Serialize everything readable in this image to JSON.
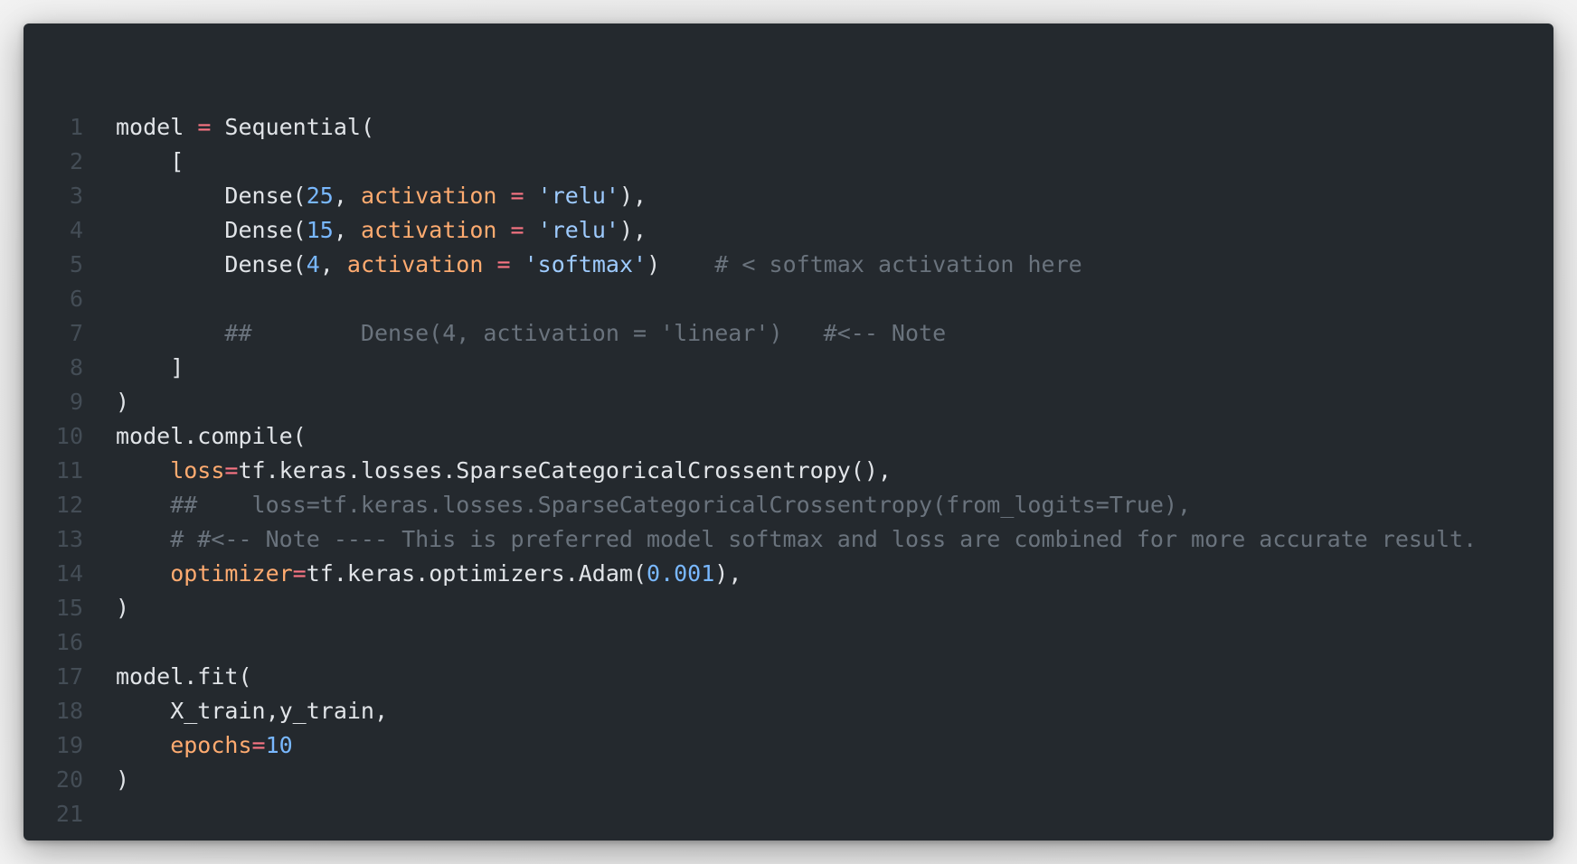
{
  "editor": {
    "theme_colors": {
      "background": "#24292e",
      "text": "#e1e4e8",
      "line_number": "#444d56",
      "operator": "#f97583",
      "keyword_arg": "#ffab70",
      "number": "#79b8ff",
      "string": "#9ecbff",
      "comment": "#6a737d"
    },
    "lines": [
      {
        "n": "1",
        "tokens": [
          [
            "id",
            "model "
          ],
          [
            "op",
            "="
          ],
          [
            "id",
            " Sequential("
          ]
        ]
      },
      {
        "n": "2",
        "tokens": [
          [
            "id",
            "    ["
          ]
        ]
      },
      {
        "n": "3",
        "tokens": [
          [
            "id",
            "        Dense("
          ],
          [
            "num",
            "25"
          ],
          [
            "id",
            ", "
          ],
          [
            "kw",
            "activation"
          ],
          [
            "id",
            " "
          ],
          [
            "op",
            "="
          ],
          [
            "id",
            " "
          ],
          [
            "str",
            "'relu'"
          ],
          [
            "id",
            "),"
          ]
        ]
      },
      {
        "n": "4",
        "tokens": [
          [
            "id",
            "        Dense("
          ],
          [
            "num",
            "15"
          ],
          [
            "id",
            ", "
          ],
          [
            "kw",
            "activation"
          ],
          [
            "id",
            " "
          ],
          [
            "op",
            "="
          ],
          [
            "id",
            " "
          ],
          [
            "str",
            "'relu'"
          ],
          [
            "id",
            "),"
          ]
        ]
      },
      {
        "n": "5",
        "tokens": [
          [
            "id",
            "        Dense("
          ],
          [
            "num",
            "4"
          ],
          [
            "id",
            ", "
          ],
          [
            "kw",
            "activation"
          ],
          [
            "id",
            " "
          ],
          [
            "op",
            "="
          ],
          [
            "id",
            " "
          ],
          [
            "str",
            "'softmax'"
          ],
          [
            "id",
            ")"
          ],
          [
            "com",
            "    # < softmax activation here"
          ]
        ]
      },
      {
        "n": "6",
        "tokens": []
      },
      {
        "n": "7",
        "tokens": [
          [
            "com",
            "        ##        Dense(4, activation = 'linear')   #<-- Note"
          ]
        ]
      },
      {
        "n": "8",
        "tokens": [
          [
            "id",
            "    ]"
          ]
        ]
      },
      {
        "n": "9",
        "tokens": [
          [
            "id",
            ")"
          ]
        ]
      },
      {
        "n": "10",
        "tokens": [
          [
            "id",
            "model.compile("
          ]
        ]
      },
      {
        "n": "11",
        "tokens": [
          [
            "kw",
            "    loss"
          ],
          [
            "op",
            "="
          ],
          [
            "id",
            "tf.keras.losses.SparseCategoricalCrossentropy(),"
          ]
        ]
      },
      {
        "n": "12",
        "tokens": [
          [
            "com",
            "    ##    loss=tf.keras.losses.SparseCategoricalCrossentropy(from_logits=True),"
          ]
        ]
      },
      {
        "n": "13",
        "tokens": [
          [
            "com",
            "    # #<-- Note ---- This is preferred model softmax and loss are combined for more accurate result."
          ]
        ]
      },
      {
        "n": "14",
        "tokens": [
          [
            "kw",
            "    optimizer"
          ],
          [
            "op",
            "="
          ],
          [
            "id",
            "tf.keras.optimizers.Adam("
          ],
          [
            "num",
            "0.001"
          ],
          [
            "id",
            "),"
          ]
        ]
      },
      {
        "n": "15",
        "tokens": [
          [
            "id",
            ")"
          ]
        ]
      },
      {
        "n": "16",
        "tokens": []
      },
      {
        "n": "17",
        "tokens": [
          [
            "id",
            "model.fit("
          ]
        ]
      },
      {
        "n": "18",
        "tokens": [
          [
            "id",
            "    X_train,y_train,"
          ]
        ]
      },
      {
        "n": "19",
        "tokens": [
          [
            "kw",
            "    epochs"
          ],
          [
            "op",
            "="
          ],
          [
            "num",
            "10"
          ]
        ]
      },
      {
        "n": "20",
        "tokens": [
          [
            "id",
            ")"
          ]
        ]
      },
      {
        "n": "21",
        "tokens": []
      }
    ]
  }
}
